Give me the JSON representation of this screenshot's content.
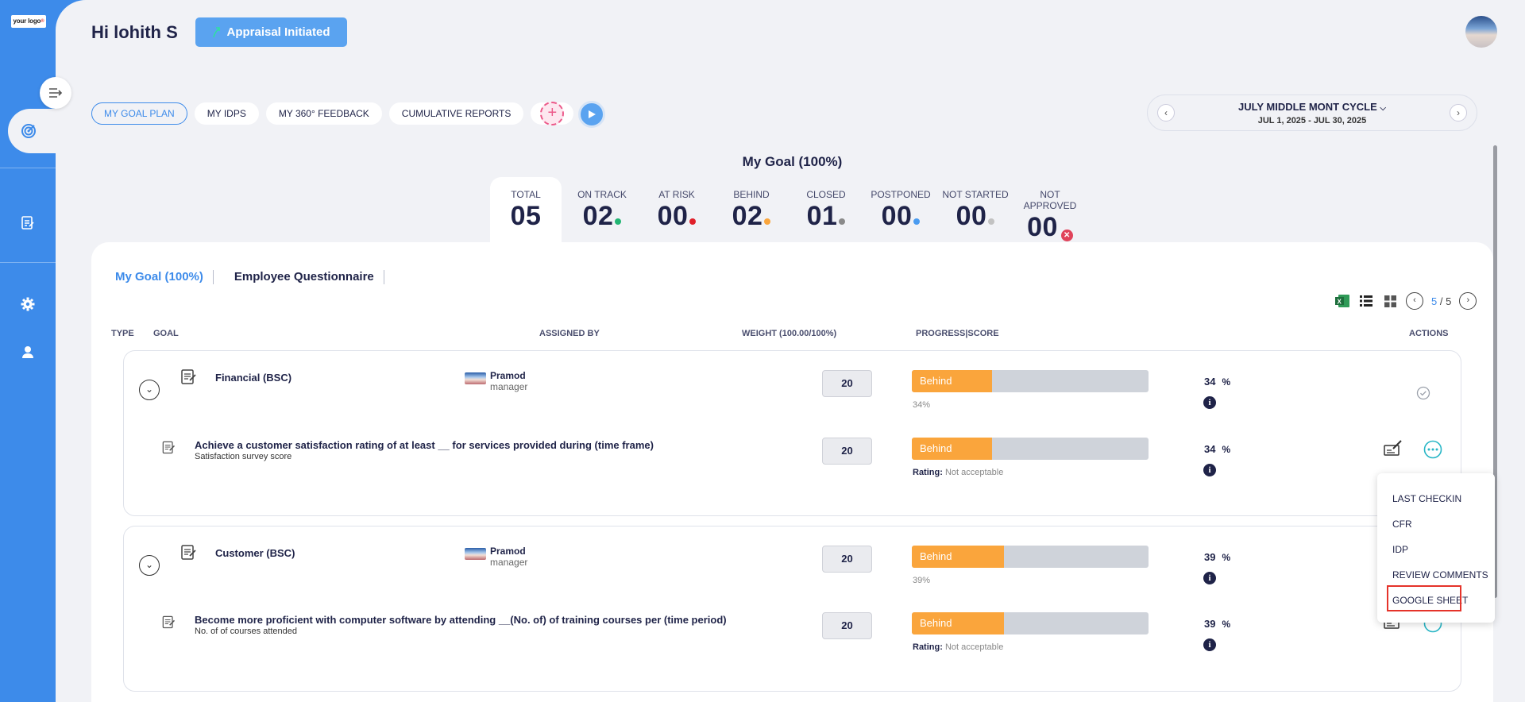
{
  "sidebar": {
    "logo_text": "your logo",
    "icons": [
      "collapse-icon",
      "target-icon",
      "document-edit-icon",
      "gear-icon",
      "user-icon"
    ]
  },
  "header": {
    "greeting": "Hi lohith S",
    "appraisal_button": "Appraisal Initiated"
  },
  "tabs": [
    {
      "label": "MY GOAL PLAN",
      "active": true
    },
    {
      "label": "MY IDPS"
    },
    {
      "label": "MY 360° FEEDBACK"
    },
    {
      "label": "CUMULATIVE REPORTS"
    }
  ],
  "cycle": {
    "name": "JULY MIDDLE MONT CYCLE",
    "dates": "JUL 1, 2025 - JUL 30, 2025"
  },
  "goal_summary_title": "My Goal (100%)",
  "stats": [
    {
      "label": "TOTAL",
      "value": "05",
      "color": ""
    },
    {
      "label": "ON TRACK",
      "value": "02",
      "color": "#22b573"
    },
    {
      "label": "AT RISK",
      "value": "00",
      "color": "#e0202a"
    },
    {
      "label": "BEHIND",
      "value": "02",
      "color": "#faa53c"
    },
    {
      "label": "CLOSED",
      "value": "01",
      "color": "#8a8a8a"
    },
    {
      "label": "POSTPONED",
      "value": "00",
      "color": "#4a9bf0"
    },
    {
      "label": "NOT STARTED",
      "value": "00",
      "color": "#c2c2c2"
    },
    {
      "label": "NOT APPROVED",
      "value": "00",
      "color": "#e0435a"
    }
  ],
  "subtabs": [
    "My Goal (100%)",
    "Employee Questionnaire"
  ],
  "pagination": {
    "current": "5",
    "separator": "/",
    "total": "5"
  },
  "columns": {
    "type": "TYPE",
    "goal": "GOAL",
    "assigned_by": "ASSIGNED BY",
    "weight": "WEIGHT (100.00/100%)",
    "progress": "PROGRESS|SCORE",
    "actions": "ACTIONS"
  },
  "goals": [
    {
      "category": "Financial (BSC)",
      "assignee_name": "Pramod",
      "assignee_role": "manager",
      "weight": "20",
      "status": "Behind",
      "progress": 34,
      "progress_label": "34%",
      "pct": "34",
      "child": {
        "title": "Achieve a customer satisfaction rating of at least __ for services provided during (time frame)",
        "subtitle": "Satisfaction survey score",
        "weight": "20",
        "status": "Behind",
        "progress": 34,
        "rating_label": "Rating:",
        "rating_value": "Not acceptable",
        "pct": "34"
      }
    },
    {
      "category": "Customer (BSC)",
      "assignee_name": "Pramod",
      "assignee_role": "manager",
      "weight": "20",
      "status": "Behind",
      "progress": 39,
      "progress_label": "39%",
      "pct": "39",
      "child": {
        "title": "Become more proficient with computer software by attending __(No. of) of training courses per (time period)",
        "subtitle": "No. of of courses attended",
        "weight": "20",
        "status": "Behind",
        "progress": 39,
        "rating_label": "Rating:",
        "rating_value": "Not acceptable",
        "pct": "39"
      }
    }
  ],
  "percent_sign": "%",
  "actions_menu": [
    "LAST CHECKIN",
    "CFR",
    "IDP",
    "REVIEW COMMENTS",
    "GOOGLE SHEET"
  ]
}
